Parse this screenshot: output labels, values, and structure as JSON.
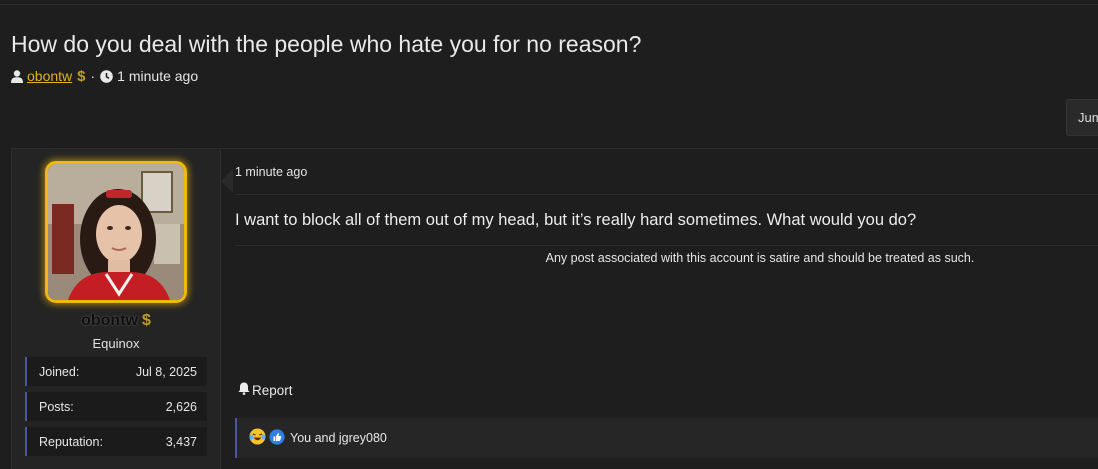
{
  "thread": {
    "title": "How do you deal with the people who hate you for no reason?",
    "author": "obontw",
    "author_badge": "$",
    "time": "1 minute ago",
    "separator": "·"
  },
  "jump_button": {
    "label": "Jump"
  },
  "post": {
    "time": "1 minute ago",
    "body": "I want to block all of them out of my head, but it’s really hard sometimes. What would you do?",
    "signature": "Any post associated with this account is satire and should be treated as such.",
    "report_label": "Report",
    "reactions_text": "You and jgrey080",
    "reaction_icons": [
      "laughing-crying-emoji",
      "thumbs-up"
    ]
  },
  "user": {
    "name": "obontw",
    "badge": "$",
    "title": "Equinox",
    "stats": [
      {
        "label": "Joined:",
        "value": "Jul 8, 2025"
      },
      {
        "label": "Posts:",
        "value": "2,626"
      },
      {
        "label": "Reputation:",
        "value": "3,437"
      }
    ]
  },
  "colors": {
    "background": "#1e1e1e",
    "author_link": "#e5b21a",
    "avatar_border": "#f1b90f",
    "accent_bar": "#4e55a8"
  }
}
